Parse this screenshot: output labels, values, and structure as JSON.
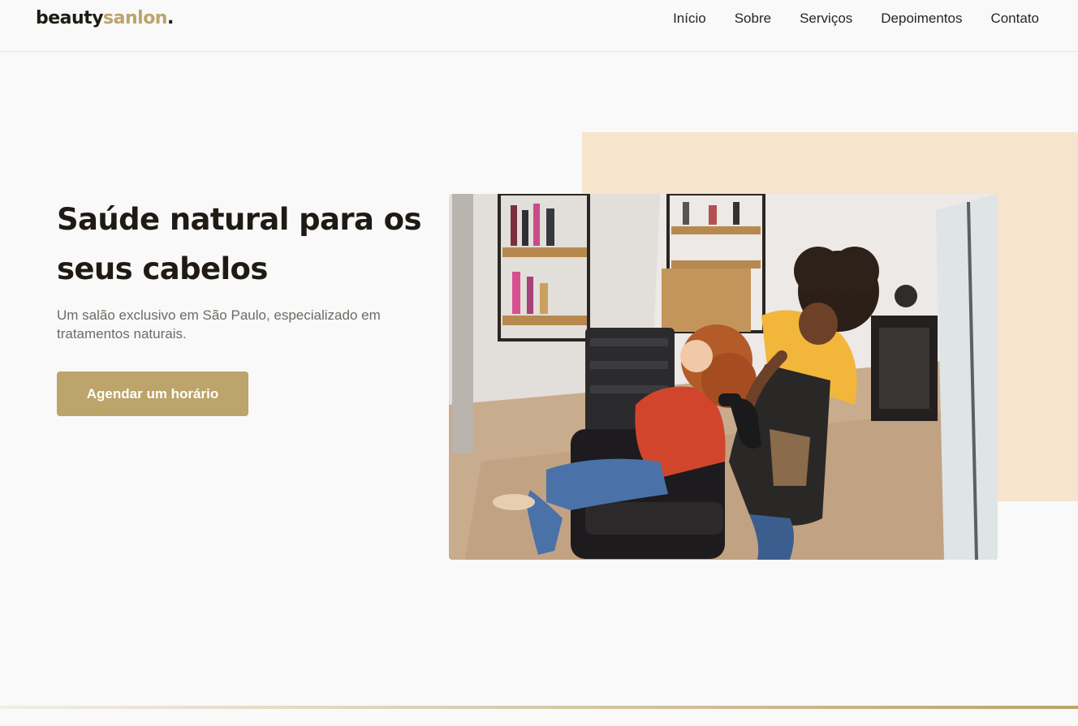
{
  "brand": {
    "part1": "beauty",
    "part2": "sanlon",
    "part3": "."
  },
  "nav": {
    "items": [
      {
        "label": "Início"
      },
      {
        "label": "Sobre"
      },
      {
        "label": "Serviços"
      },
      {
        "label": "Depoimentos"
      },
      {
        "label": "Contato"
      }
    ]
  },
  "hero": {
    "title": "Saúde natural para os seus cabelos",
    "subtitle": "Um salão exclusivo em São Paulo, especializado em tratamentos naturais.",
    "cta_label": "Agendar um horário"
  },
  "colors": {
    "accent": "#bca46a",
    "dark_text": "#1f1a14",
    "beige_block": "#f6e5cc",
    "background": "#f9f9f9"
  }
}
